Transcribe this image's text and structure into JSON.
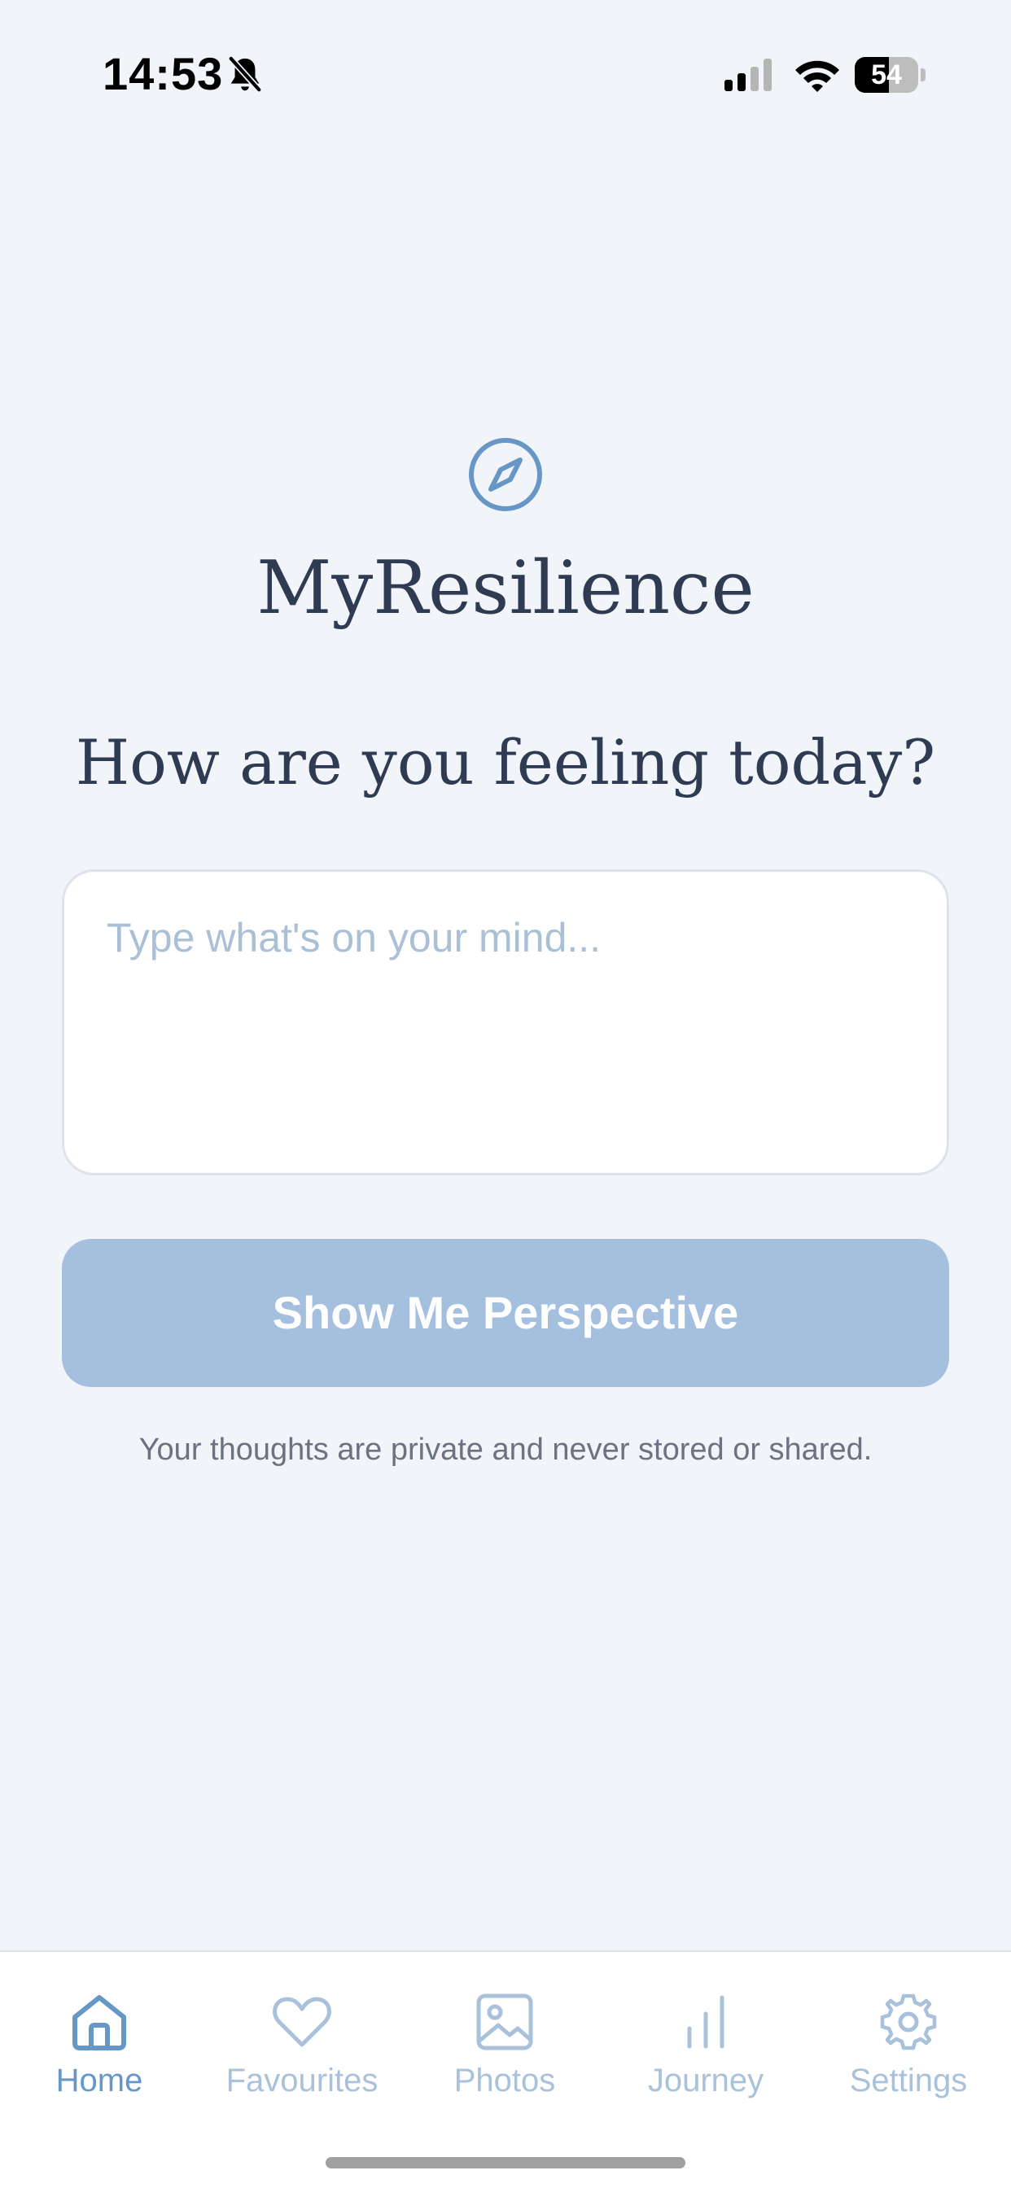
{
  "status_bar": {
    "time": "14:53",
    "battery_level": "54",
    "battery_fraction": 0.54,
    "icons": [
      "bell-slash-icon",
      "cellular-signal-icon",
      "wifi-icon",
      "battery-icon"
    ]
  },
  "app": {
    "logo_icon": "compass-icon",
    "title": "MyResilience"
  },
  "main": {
    "prompt_heading": "How are you feeling today?",
    "input_placeholder": "Type what's on your mind...",
    "input_value": "",
    "submit_label": "Show Me Perspective",
    "privacy_note": "Your thoughts are private and never stored or shared."
  },
  "tab_bar": {
    "active": "Home",
    "items": [
      {
        "label": "Home",
        "icon": "home-icon"
      },
      {
        "label": "Favourites",
        "icon": "heart-icon"
      },
      {
        "label": "Photos",
        "icon": "image-icon"
      },
      {
        "label": "Journey",
        "icon": "bar-chart-icon"
      },
      {
        "label": "Settings",
        "icon": "gear-icon"
      }
    ]
  },
  "colors": {
    "background": "#f1f4f8",
    "accent": "#6797c6",
    "button": "#a5c0df",
    "heading": "#2f3b52",
    "tab_inactive": "#a9c1da"
  }
}
